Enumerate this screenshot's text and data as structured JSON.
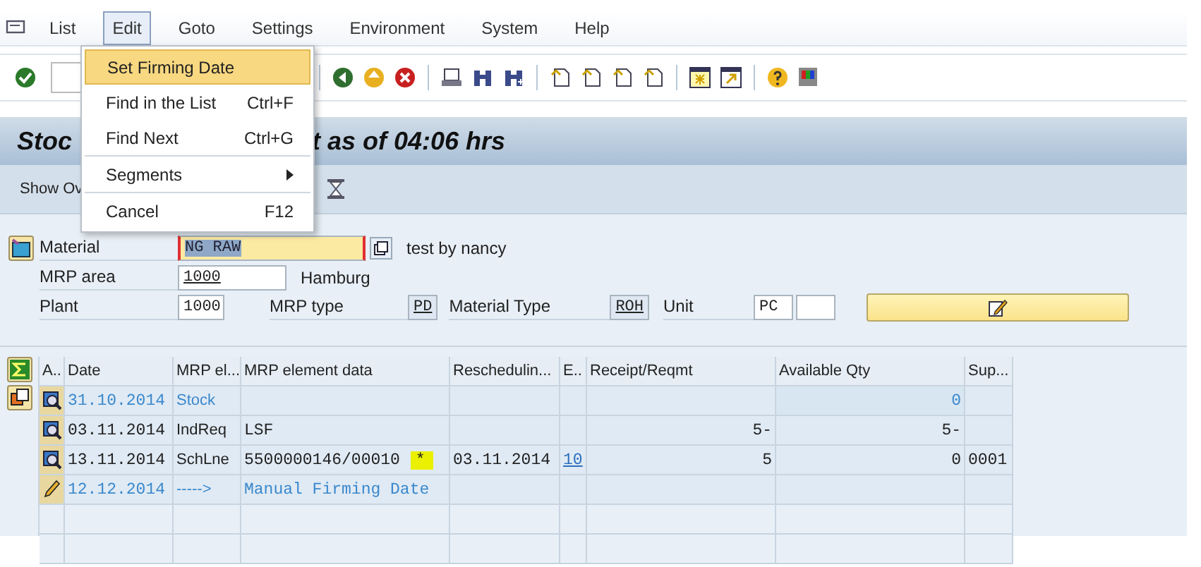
{
  "menu_bar": {
    "items": [
      {
        "label": "List",
        "selected": false
      },
      {
        "label": "Edit",
        "selected": true
      },
      {
        "label": "Goto",
        "selected": false
      },
      {
        "label": "Settings",
        "selected": false
      },
      {
        "label": "Environment",
        "selected": false
      },
      {
        "label": "System",
        "selected": false
      },
      {
        "label": "Help",
        "selected": false
      }
    ]
  },
  "dropdown": {
    "items": [
      {
        "kind": "item",
        "label": "Set Firming Date",
        "selected": true
      },
      {
        "kind": "item",
        "label": "Find in the List",
        "shortcut": "Ctrl+F",
        "selected": false
      },
      {
        "kind": "item",
        "label": "Find Next",
        "shortcut": "Ctrl+G",
        "selected": false
      },
      {
        "kind": "separator"
      },
      {
        "kind": "submenu",
        "label": "Segments",
        "selected": false
      },
      {
        "kind": "separator"
      },
      {
        "kind": "item",
        "label": "Cancel",
        "shortcut": "F12",
        "selected": false
      }
    ]
  },
  "title_bar": {
    "title_start": "Stoc",
    "title_end": "t as of 04:06 hrs"
  },
  "app_toolbar": {
    "button_text": "Show Ov"
  },
  "form": {
    "material": {
      "label": "Material",
      "value": "NG RAW",
      "description": "test by nancy"
    },
    "mrp_area": {
      "label": "MRP area",
      "value": "1000",
      "description": "Hamburg"
    },
    "plant": {
      "label": "Plant",
      "value": "1000"
    },
    "mrp_type": {
      "label": "MRP type",
      "value": "PD"
    },
    "material_type": {
      "label": "Material Type",
      "value": "ROH"
    },
    "unit": {
      "label": "Unit",
      "value": "PC"
    }
  },
  "table": {
    "columns": [
      "A..",
      "Date",
      "MRP el...",
      "MRP element data",
      "Reschedulin...",
      "E..",
      "Receipt/Reqmt",
      "Available Qty",
      "Sup..."
    ],
    "rows": [
      {
        "kind": "stock",
        "date": "31.10.2014",
        "element": "Stock",
        "available": "0"
      },
      {
        "kind": "requirement",
        "date": "03.11.2014",
        "element": "IndReq",
        "data": "LSF",
        "receipt": "5-",
        "available": "5-"
      },
      {
        "kind": "receipt",
        "date": "13.11.2014",
        "element": "SchLne",
        "data": "5500000146/00010",
        "flag": "*",
        "flag_highlighted": true,
        "rescheduling": "03.11.2014",
        "exception": "10",
        "receipt": "5",
        "available": "0",
        "supplier": "0001"
      },
      {
        "kind": "firming",
        "date": "12.12.2014",
        "element": "----->",
        "data": "Manual Firming Date"
      }
    ]
  }
}
